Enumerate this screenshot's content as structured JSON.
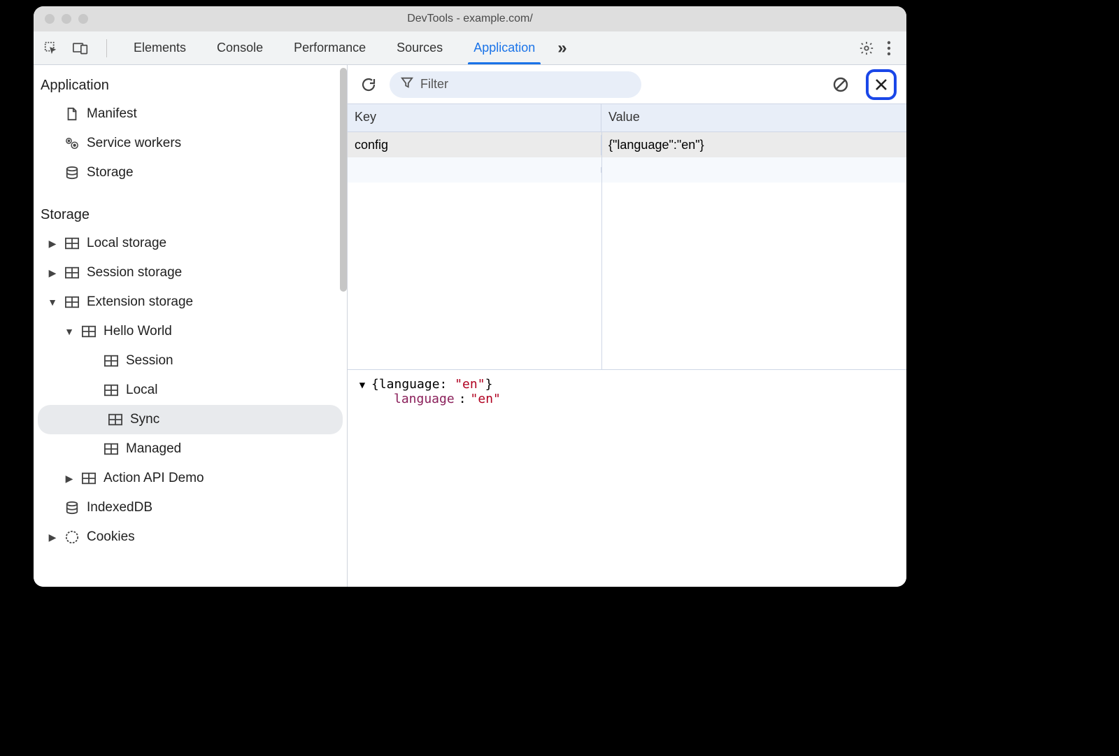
{
  "window": {
    "title": "DevTools - example.com/"
  },
  "tabs": {
    "items": [
      "Elements",
      "Console",
      "Performance",
      "Sources",
      "Application"
    ],
    "active": "Application",
    "more_glyph": "»"
  },
  "sidebar": {
    "section_application": "Application",
    "app_items": {
      "manifest": "Manifest",
      "service_workers": "Service workers",
      "storage": "Storage"
    },
    "section_storage": "Storage",
    "storage_items": {
      "local_storage": "Local storage",
      "session_storage": "Session storage",
      "extension_storage": "Extension storage",
      "hello_world": "Hello World",
      "session": "Session",
      "local": "Local",
      "sync": "Sync",
      "managed": "Managed",
      "action_api_demo": "Action API Demo",
      "indexeddb": "IndexedDB",
      "cookies": "Cookies"
    }
  },
  "toolbar": {
    "filter_placeholder": "Filter"
  },
  "table": {
    "headers": {
      "key": "Key",
      "value": "Value"
    },
    "rows": [
      {
        "key": "config",
        "value": "{\"language\":\"en\"}"
      }
    ]
  },
  "preview": {
    "summary_prefix": "{language: ",
    "summary_str": "\"en\"",
    "summary_suffix": "}",
    "prop_name": "language",
    "prop_colon": ": ",
    "prop_value": "\"en\""
  }
}
